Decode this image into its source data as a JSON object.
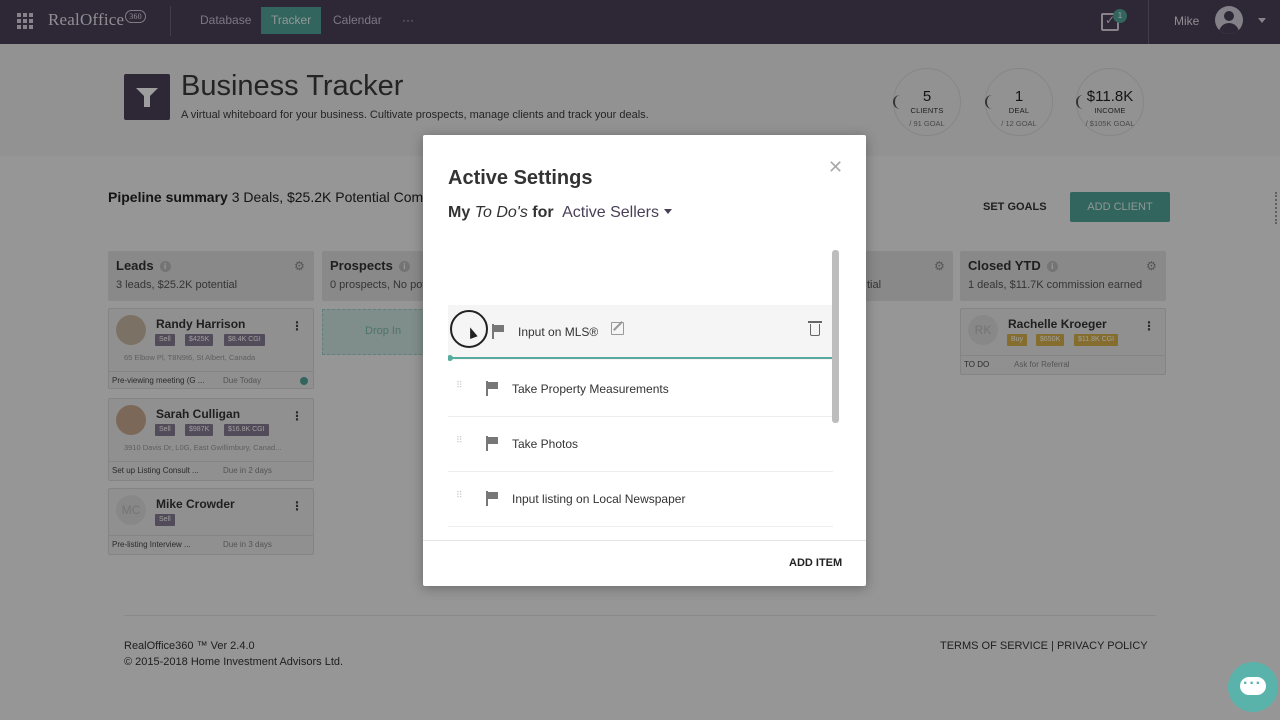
{
  "nav": {
    "logo": "RealOffice",
    "logo_badge": "360",
    "links": [
      "Database",
      "Tracker",
      "Calendar",
      "···"
    ],
    "active_link": "Tracker",
    "notification_count": "1",
    "user_name": "Mike"
  },
  "header": {
    "title": "Business Tracker",
    "subtitle": "A virtual whiteboard for your business. Cultivate prospects, manage clients and track your deals.",
    "goals": [
      {
        "value": "5",
        "label": "CLIENTS",
        "goal": "/ 91 GOAL"
      },
      {
        "value": "1",
        "label": "DEAL",
        "goal": "/ 12 GOAL"
      },
      {
        "value": "$11.8K",
        "label": "INCOME",
        "goal": "/ $105K GOAL"
      }
    ]
  },
  "pipeline": {
    "title": "Pipeline summary",
    "summary": "3 Deals, $25.2K Potential Com",
    "set_goals": "SET GOALS",
    "add_client": "ADD CLIENT"
  },
  "columns": {
    "leads": {
      "title": "Leads",
      "sub": "3 leads, $25.2K potential"
    },
    "prospects": {
      "title": "Prospects",
      "sub": "0 prospects, No pote"
    },
    "hidden_sub": "tial",
    "closed": {
      "title": "Closed YTD",
      "sub": "1 deals, $11.7K commission earned"
    },
    "drop_text": "Drop In"
  },
  "cards": [
    {
      "name": "Randy Harrison",
      "tags": [
        "Sell",
        "$425K",
        "$8.4K CGI"
      ],
      "addr": "65 Elbow Pl, T8N9t6, St Albert, Canada",
      "todo": "Pre-viewing meeting (G ...",
      "due": "Due Today"
    },
    {
      "name": "Sarah Culligan",
      "tags": [
        "Sell",
        "$987K",
        "$16.8K CGI"
      ],
      "addr": "3910 Davis Dr, L0G, East Gwillimbury, Canad...",
      "todo": "Set up Listing Consult ...",
      "due": "Due in 2 days"
    },
    {
      "name": "Mike Crowder",
      "initials": "MC",
      "tags": [
        "Sell"
      ],
      "todo": "Pre-listing Interview ...",
      "due": "Due in 3 days"
    }
  ],
  "closed_card": {
    "name": "Rachelle Kroeger",
    "initials": "RK",
    "tags": [
      "Buy",
      "$650K",
      "$11.8K CGI"
    ],
    "todo_label": "TO DO",
    "todo": "Ask for Referral"
  },
  "footer": {
    "version": "RealOffice360 ™ Ver 2.4.0",
    "copyright": "© 2015-2018 Home Investment Advisors Ltd.",
    "links": "TERMS OF SERVICE | PRIVACY POLICY"
  },
  "modal": {
    "title": "Active Settings",
    "sub_my": "My",
    "sub_todos": "To Do's",
    "sub_for": "for",
    "selected": "Active Sellers",
    "items": [
      "Input on MLS®",
      "Take Property Measurements",
      "Take Photos",
      "Input listing on Local Newspaper"
    ],
    "add_item": "ADD ITEM"
  },
  "colors": {
    "nav_bg": "#4a3f57",
    "accent": "#4fa396",
    "tag": "#857b91"
  }
}
